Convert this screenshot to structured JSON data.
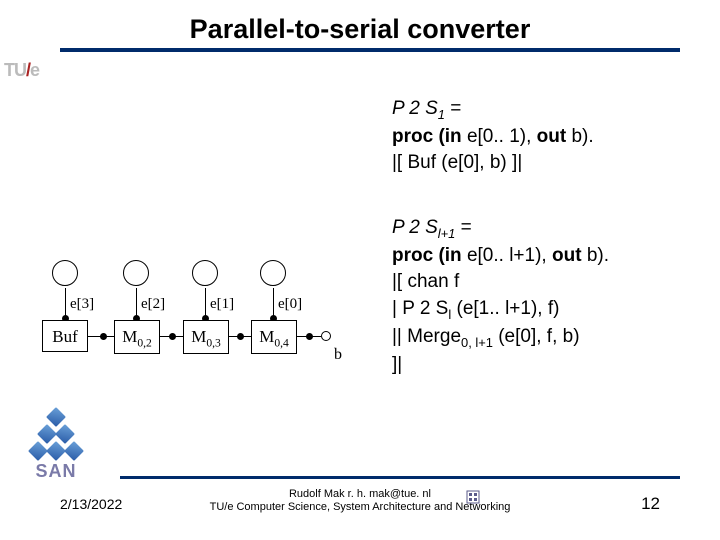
{
  "title": "Parallel-to-serial converter",
  "logo_tue": {
    "t": "TU",
    "slash": "/",
    "e": "e"
  },
  "spec1": {
    "l1a": "P 2 S",
    "l1a_sub": "1",
    "l1b": " =",
    "l2a": "proc (in ",
    "l2b": "e[0.. 1), ",
    "l2c": "out ",
    "l2d": "b).",
    "l3": "|[ Buf (e[0], b) ]|"
  },
  "spec2": {
    "l1a": "P 2 S",
    "l1a_sub": "l+1",
    "l1b": " =",
    "l2a": "proc (in ",
    "l2b": "e[0.. l+1), ",
    "l2c": "out ",
    "l2d": "b).",
    "l3": "|[ chan ",
    "l3b": "f",
    "l4a": "|  P 2 S",
    "l4a_sub": "l",
    "l4b": " (e[1.. l+1), f)",
    "l5a": "|| Merge",
    "l5a_sub": "0, l+1",
    "l5b": " (e[0], f, b)",
    "l6": "]|"
  },
  "diagram": {
    "e3": "e[3]",
    "e2": "e[2]",
    "e1": "e[1]",
    "e0": "e[0]",
    "buf": "Buf",
    "m02a": "M",
    "m02b": "0,2",
    "m03a": "M",
    "m03b": "0,3",
    "m04a": "M",
    "m04b": "0,4",
    "b": "b"
  },
  "san": "SAN",
  "footer": {
    "date": "2/13/2022",
    "line1": "Rudolf Mak  r. h. mak@tue. nl",
    "line2": "TU/e Computer Science, System Architecture and Networking",
    "page": "12"
  }
}
